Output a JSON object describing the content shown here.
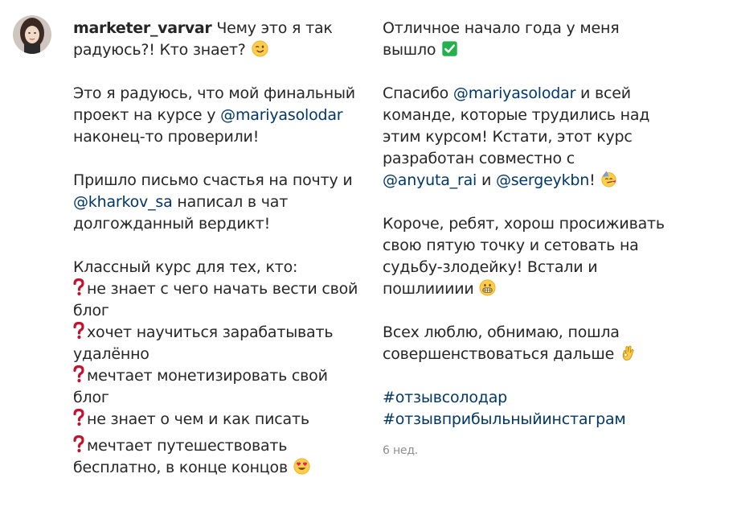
{
  "post": {
    "username": "marketer_varvar",
    "timestamp": "6 нед.",
    "left": {
      "p1_l1_text": " Чему это я так",
      "p1_l2_text": "радуюсь?! Кто знает? ",
      "p2_l1": "Это я радуюсь, что мой финальный",
      "p2_l2_text": "проект на курсе у ",
      "p2_l2_mention": "@mariyasolodar",
      "p2_l3": "наконец-то проверили!",
      "p3_l1": "Пришло письмо счастья на почту и",
      "p3_l2_mention": "@kharkov_sa",
      "p3_l2_text": " написал в чат",
      "p3_l3": "долгожданный вердикт!",
      "p4_heading": "Классный курс для тех, кто:",
      "b1_l1": "не знает с чего начать вести свой",
      "b1_l2": "блог",
      "b2_l1": "хочет научиться зарабатывать",
      "b2_l2": "удалённо",
      "b3_l1": "мечтает монетизировать свой",
      "b3_l2": "блог",
      "b4_l1": "не знает о чем и как писать",
      "b5_l1": "мечтает путешествовать",
      "b5_l2_text": "бесплатно, в конце концов "
    },
    "right": {
      "p1_l1": "Отличное начало года у меня",
      "p1_l2_text": "вышло ",
      "p2_l1_text": "Спасибо ",
      "p2_l1_mention": "@mariyasolodar",
      "p2_l1_text2": " и всей",
      "p2_l2": "команде, которые трудились над",
      "p2_l3": "этим курсом! Кстати, этот курс",
      "p2_l4": "разработан совместно с",
      "p2_l5_mention1": "@anyuta_rai",
      "p2_l5_and": " и ",
      "p2_l5_mention2": "@sergeykbn",
      "p2_l5_text": "! ",
      "p3_l1": "Короче, ребят, хорош просиживать",
      "p3_l2": "свою пятую точку и сетовать на",
      "p3_l3": "судьбу-злодейку! Встали и",
      "p3_l4_text": "пошлиииии ",
      "p4_l1": "Всех люблю, обнимаю, пошла",
      "p4_l2_text": "совершенствоваться дальше ",
      "hashtag1": "#отзывсолодар",
      "hashtag2": "#отзывприбыльныйинстаграм"
    }
  },
  "icons": {
    "avatar": "user-avatar",
    "wink": "winking-face-emoji",
    "question": "red-question-mark-emoji",
    "heart_eyes": "heart-eyes-emoji",
    "check": "check-mark-button-emoji",
    "partying": "partying-face-emoji",
    "grin": "grimacing-grin-emoji",
    "ok_hand": "ok-hand-emoji"
  },
  "colors": {
    "text": "#262626",
    "link": "#00376b",
    "muted": "#8e8e8e",
    "emoji_yellow": "#ffcc4d",
    "question_red": "#c8102e",
    "check_green": "#22b14c"
  }
}
